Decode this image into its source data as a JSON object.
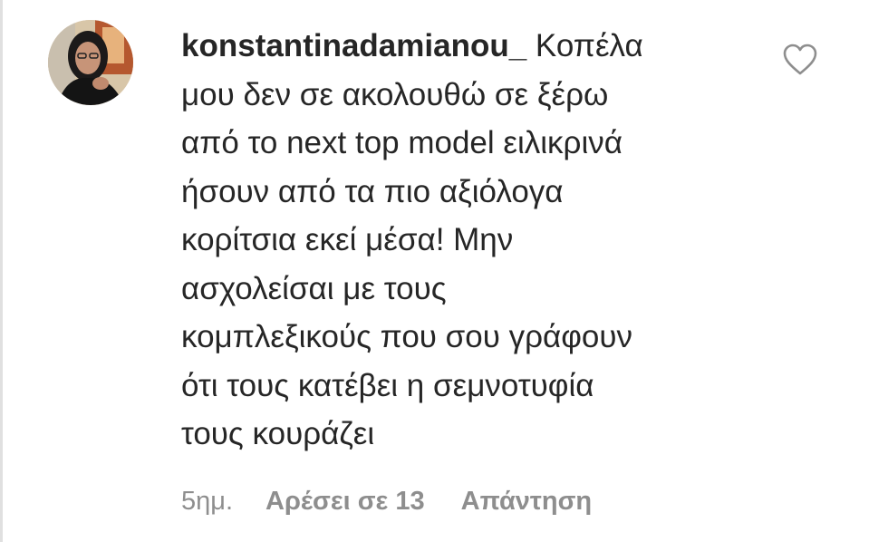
{
  "comment": {
    "username": "konstantinadamianou_",
    "text": "Κοπέλα\nμου δεν σε ακολουθώ σε ξέρω\nαπό το next top model ειλικρινά\nήσουν από τα πιο αξιόλογα\nκορίτσια εκεί μέσα! Μην\nασχολείσαι με τους\nκομπλεξικούς που σου γράφουν\nότι τους κατέβει η σεμνοτυφία\nτους κουράζει",
    "time": "5ημ.",
    "likes_label": "Αρέσει σε 13",
    "reply_label": "Απάντηση"
  },
  "icons": {
    "avatar": "profile-photo",
    "like": "heart-outline-icon"
  },
  "colors": {
    "text": "#262626",
    "muted": "#8e8e8e",
    "heart_stroke": "#8e8e8e"
  }
}
